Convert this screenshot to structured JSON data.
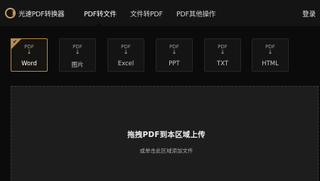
{
  "app": {
    "title": "光速PDF转换器"
  },
  "nav": {
    "tabs": [
      {
        "label": "PDF转文件",
        "active": true
      },
      {
        "label": "文件转PDF",
        "active": false
      },
      {
        "label": "PDF其他操作",
        "active": false
      }
    ],
    "login_label": "登录"
  },
  "formats": [
    {
      "from": "PDF",
      "arrow": "↓",
      "to": "Word",
      "selected": true
    },
    {
      "from": "PDF",
      "arrow": "↓",
      "to": "图片",
      "selected": false
    },
    {
      "from": "PDF",
      "arrow": "↓",
      "to": "Excel",
      "selected": false
    },
    {
      "from": "PDF",
      "arrow": "↓",
      "to": "PPT",
      "selected": false
    },
    {
      "from": "PDF",
      "arrow": "↓",
      "to": "TXT",
      "selected": false
    },
    {
      "from": "PDF",
      "arrow": "↓",
      "to": "HTML",
      "selected": false
    }
  ],
  "dropzone": {
    "title": "拖拽PDF到本区域上传",
    "subtitle": "或单击此区域添加文件"
  },
  "colors": {
    "accent": "#b58a4a",
    "background": "#0b0b0b",
    "topbar": "#141414",
    "dropzone": "#1d1d1d"
  },
  "icons": {
    "logo": "app-logo-icon",
    "selected": "check-icon"
  }
}
